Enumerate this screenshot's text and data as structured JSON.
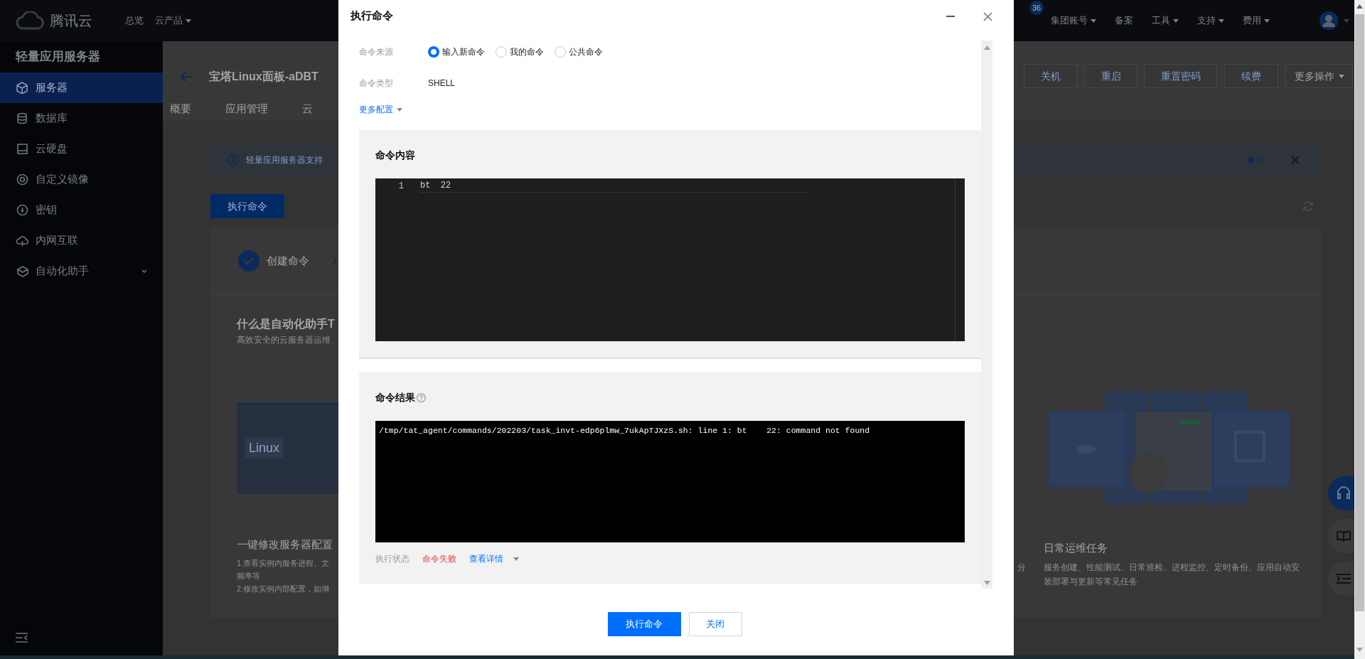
{
  "topbar": {
    "brand": "腾讯云",
    "nav": [
      {
        "label": "总览",
        "dropdown": false
      },
      {
        "label": "云产品",
        "dropdown": true
      }
    ],
    "notification_count": "36",
    "right_nav": [
      {
        "label": "集团账号",
        "dropdown": true
      },
      {
        "label": "备案",
        "dropdown": false
      },
      {
        "label": "工具",
        "dropdown": true
      },
      {
        "label": "支持",
        "dropdown": true
      },
      {
        "label": "费用",
        "dropdown": true
      }
    ]
  },
  "sidebar": {
    "title": "轻量应用服务器",
    "items": [
      {
        "label": "服务器",
        "selected": true,
        "expandable": false
      },
      {
        "label": "数据库",
        "selected": false,
        "expandable": false
      },
      {
        "label": "云硬盘",
        "selected": false,
        "expandable": false
      },
      {
        "label": "自定义镜像",
        "selected": false,
        "expandable": false
      },
      {
        "label": "密钥",
        "selected": false,
        "expandable": false
      },
      {
        "label": "内网互联",
        "selected": false,
        "expandable": false
      },
      {
        "label": "自动化助手",
        "selected": false,
        "expandable": true
      }
    ]
  },
  "page": {
    "title": "宝塔Linux面板-aDBT",
    "tabs": [
      "概要",
      "应用管理",
      "云"
    ],
    "actions": [
      {
        "label": "关机",
        "dropdown": false
      },
      {
        "label": "重启",
        "dropdown": false
      },
      {
        "label": "重置密码",
        "dropdown": false
      },
      {
        "label": "续费",
        "dropdown": false
      },
      {
        "label": "更多操作",
        "dropdown": true
      }
    ],
    "banner": {
      "text": "轻量应用服务器支持",
      "dots": [
        {
          "selected": true
        },
        {
          "selected": false
        }
      ]
    },
    "execute_button": "执行命令",
    "steps": [
      {
        "label": "创建命令",
        "done": true
      }
    ],
    "intro": {
      "title": "什么是自动化助手T",
      "subtitle": "高效安全的云服务器运维",
      "illustration_label": "Linux",
      "partial_text": "分",
      "features": [
        {
          "title": "一键修改服务器配置",
          "lines": [
            "1.查看实例内服务进程、文",
            "频率等",
            "2.修改实例内部配置，如增"
          ]
        },
        {
          "title": "日常运维任务",
          "lines": [
            "服务创建、性能测试、日常巡检、进程监控、定时备份、应用自动安装部署与更新等常见任务"
          ]
        }
      ]
    }
  },
  "dialog": {
    "title": "执行命令",
    "source": {
      "label": "命令来源",
      "options": [
        {
          "label": "输入新命令",
          "selected": true
        },
        {
          "label": "我的命令",
          "selected": false
        },
        {
          "label": "公共命令",
          "selected": false
        }
      ]
    },
    "type": {
      "label": "命令类型",
      "value": "SHELL"
    },
    "more_config": "更多配置",
    "content": {
      "title": "命令内容",
      "lines": [
        {
          "number": "1",
          "code": "bt  22"
        }
      ]
    },
    "result": {
      "title": "命令结果",
      "output": "/tmp/tat_agent/commands/202203/task_invt-edp6plmw_7ukApTJXzS.sh: line 1: bt    22: command not found",
      "status_label": "执行状态",
      "status": "命令失败",
      "failed": true,
      "details_link": "查看详情"
    },
    "buttons": [
      {
        "label": "执行命令",
        "kind": "primary"
      },
      {
        "label": "关闭",
        "kind": "secondary"
      }
    ]
  }
}
